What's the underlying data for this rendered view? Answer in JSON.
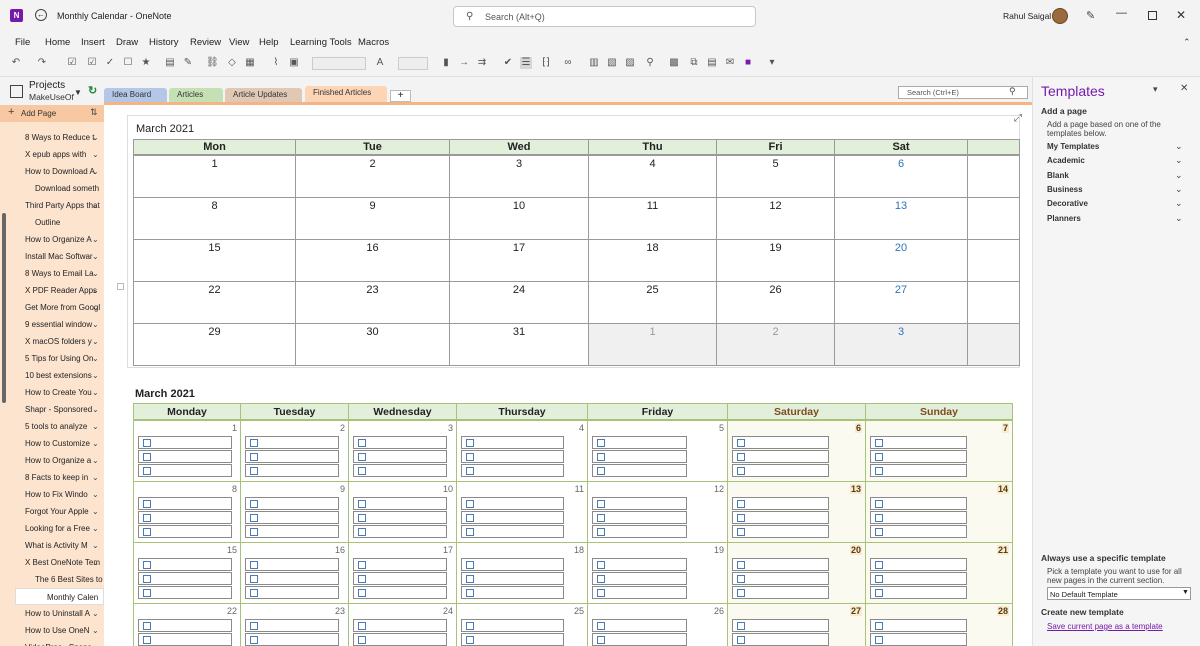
{
  "window": {
    "title": "Monthly Calendar - OneNote",
    "search_placeholder": "Search (Alt+Q)",
    "user_name": "Rahul Saigal"
  },
  "menu": [
    "File",
    "Home",
    "Insert",
    "Draw",
    "History",
    "Review",
    "View",
    "Help",
    "Learning Tools",
    "Macros"
  ],
  "notebook": {
    "name": "Projects",
    "sub": "MakeUseOf"
  },
  "tabs": [
    "Idea Board",
    "Articles",
    "Article Updates",
    "Finished Articles"
  ],
  "nav_search_placeholder": "Search (Ctrl+E)",
  "pagelist": {
    "add_page": "Add Page",
    "items": [
      {
        "label": "8 Ways to Reduce t",
        "indent": 1
      },
      {
        "label": "X epub apps with",
        "indent": 1
      },
      {
        "label": "How to Download A",
        "indent": 1
      },
      {
        "label": "Download someth",
        "indent": 2
      },
      {
        "label": "Third Party Apps that",
        "indent": 1
      },
      {
        "label": "Outline",
        "indent": 2
      },
      {
        "label": "How to Organize A",
        "indent": 1
      },
      {
        "label": "Install Mac Softwar",
        "indent": 1
      },
      {
        "label": "8 Ways to Email La",
        "indent": 1
      },
      {
        "label": "X PDF Reader Apps",
        "indent": 1
      },
      {
        "label": "Get More from Googl",
        "indent": 1
      },
      {
        "label": "9 essential window",
        "indent": 1
      },
      {
        "label": "X macOS folders y",
        "indent": 1
      },
      {
        "label": "5 Tips for Using On",
        "indent": 1
      },
      {
        "label": "10 best extensions",
        "indent": 1
      },
      {
        "label": "How to Create You",
        "indent": 1
      },
      {
        "label": "Shapr - Sponsored",
        "indent": 1
      },
      {
        "label": "5 tools to analyze",
        "indent": 1
      },
      {
        "label": "How to Customize",
        "indent": 1
      },
      {
        "label": "How to Organize a",
        "indent": 1
      },
      {
        "label": "8 Facts to keep in",
        "indent": 1
      },
      {
        "label": "How to Fix Windo",
        "indent": 1
      },
      {
        "label": "Forgot Your Apple",
        "indent": 1
      },
      {
        "label": "Looking for a Free",
        "indent": 1
      },
      {
        "label": "What is Activity M",
        "indent": 1
      },
      {
        "label": "X Best OneNote Tem",
        "indent": 1
      },
      {
        "label": "The 6 Best Sites to",
        "indent": 2
      },
      {
        "label": "Monthly Calen",
        "indent": 3,
        "selected": true
      },
      {
        "label": "How to Uninstall A",
        "indent": 1
      },
      {
        "label": "How to Use OneN",
        "indent": 1
      },
      {
        "label": "VideoProc - Spons",
        "indent": 1
      }
    ]
  },
  "cal1": {
    "title": "March 2021",
    "days": [
      "Mon",
      "Tue",
      "Wed",
      "Thu",
      "Fri",
      "Sat"
    ],
    "weeks": [
      [
        "1",
        "2",
        "3",
        "4",
        "5",
        "6"
      ],
      [
        "8",
        "9",
        "10",
        "11",
        "12",
        "13"
      ],
      [
        "15",
        "16",
        "17",
        "18",
        "19",
        "20"
      ],
      [
        "22",
        "23",
        "24",
        "25",
        "26",
        "27"
      ],
      [
        "29",
        "30",
        "31",
        "1",
        "2",
        "3"
      ]
    ]
  },
  "cal2": {
    "title": "March 2021",
    "days": [
      "Monday",
      "Tuesday",
      "Wednesday",
      "Thursday",
      "Friday",
      "Saturday",
      "Sunday"
    ],
    "weeks": [
      [
        "1",
        "2",
        "3",
        "4",
        "5",
        "6",
        "7"
      ],
      [
        "8",
        "9",
        "10",
        "11",
        "12",
        "13",
        "14"
      ],
      [
        "15",
        "16",
        "17",
        "18",
        "19",
        "20",
        "21"
      ],
      [
        "22",
        "23",
        "24",
        "25",
        "26",
        "27",
        "28"
      ]
    ]
  },
  "templates": {
    "title": "Templates",
    "add_page": "Add a page",
    "add_desc_1": "Add a page based on one of the",
    "add_desc_2": "templates below.",
    "categories": [
      "My Templates",
      "Academic",
      "Blank",
      "Business",
      "Decorative",
      "Planners"
    ],
    "always_title": "Always use a specific template",
    "always_desc_1": "Pick a template you want to use for all",
    "always_desc_2": "new pages in the current section.",
    "default_select": "No Default Template",
    "create_title": "Create new template",
    "save_link": "Save current page as a template"
  },
  "colors": {
    "accent": "#7719aa",
    "tab_idea": "#b4c7e7",
    "tab_articles": "#c5e0b4",
    "tab_updates": "#e0c8b4",
    "tab_finished": "#fbd5b5",
    "saturday_blue": "#2e75b6",
    "weekend_brown": "#7f4b1e"
  }
}
